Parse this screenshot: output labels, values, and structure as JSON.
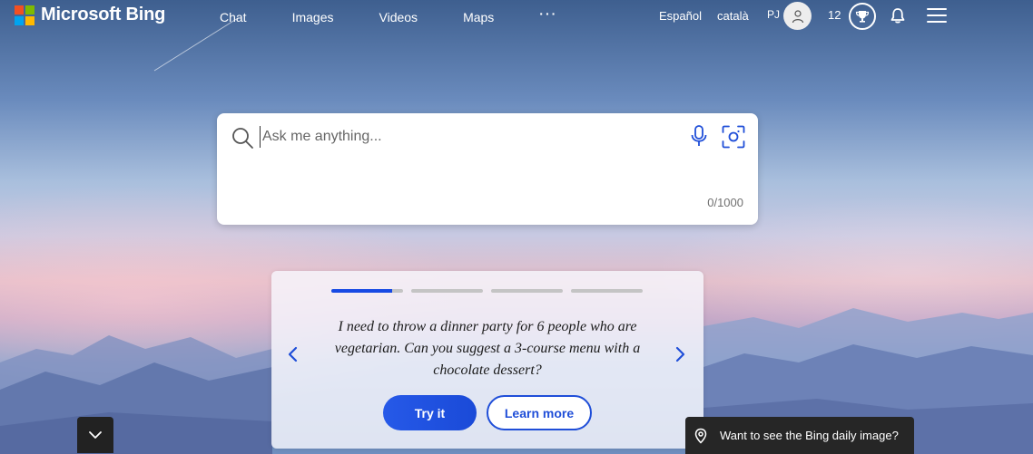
{
  "brand": {
    "name": "Microsoft Bing",
    "logo_colors": [
      "#f25022",
      "#7fba00",
      "#00a4ef",
      "#ffb900"
    ]
  },
  "nav": {
    "items": [
      "Chat",
      "Images",
      "Videos",
      "Maps"
    ],
    "more": "···"
  },
  "header_right": {
    "languages": [
      "Español",
      "català"
    ],
    "user_initials": "PJ",
    "avatar_icon": "user-icon",
    "rewards_points": "12",
    "rewards_icon": "trophy-icon",
    "notifications_icon": "bell-icon",
    "menu_icon": "hamburger-icon"
  },
  "search": {
    "placeholder": "Ask me anything...",
    "value": "",
    "char_counter": "0/1000",
    "icons": [
      "search-icon",
      "microphone-icon",
      "visual-search-icon"
    ]
  },
  "suggestion": {
    "slides_total": 4,
    "active_slide": 1,
    "active_progress": 0.85,
    "prompt": "I need to throw a dinner party for 6 people who are vegetarian. Can you suggest a 3-course menu with a chocolate dessert?",
    "try_label": "Try it",
    "learn_label": "Learn more"
  },
  "footer": {
    "scroll_icon": "chevron-down-icon",
    "daily_image_label": "Want to see the Bing daily image?",
    "daily_image_icon": "location-pin-icon"
  },
  "colors": {
    "accent": "#174ae4",
    "card_bg": "#f6f6fc",
    "dark_chip": "#262626"
  }
}
